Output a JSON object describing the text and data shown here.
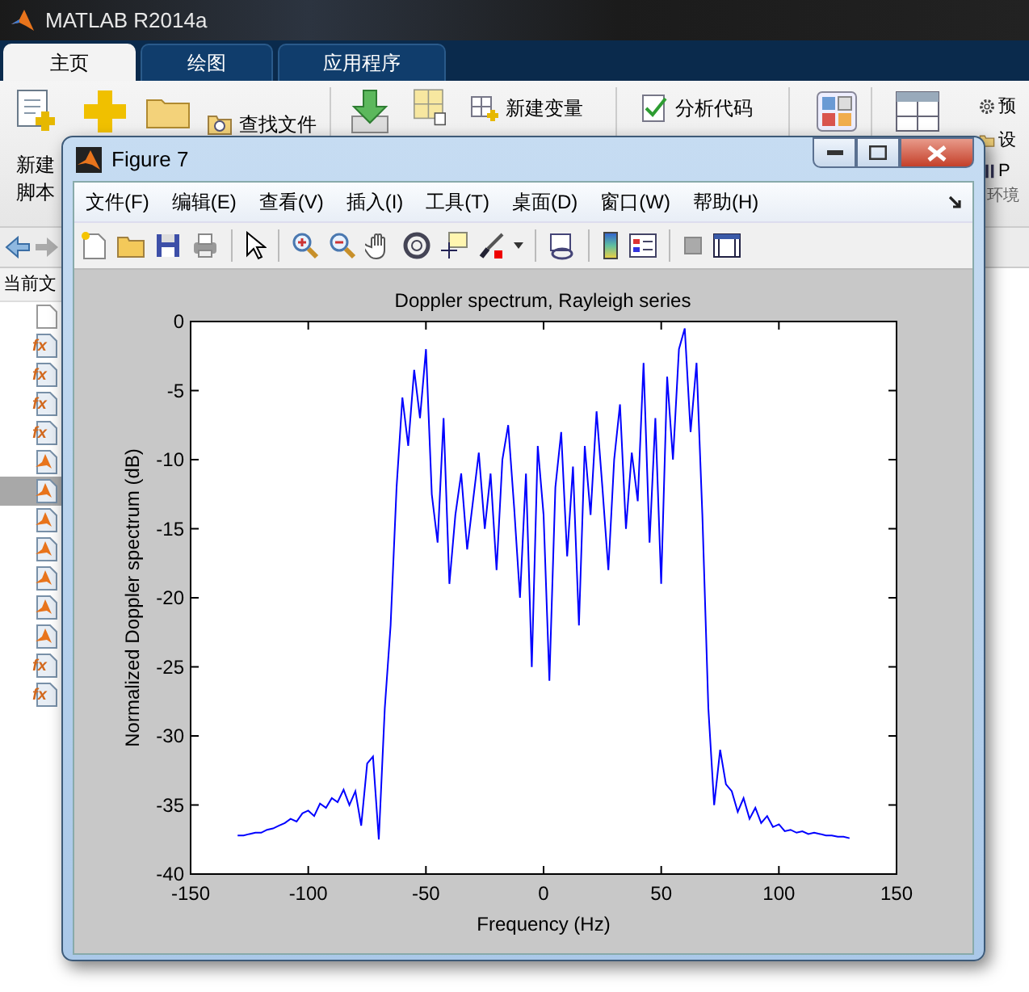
{
  "app": {
    "title": "MATLAB R2014a"
  },
  "tabs": [
    {
      "label": "主页",
      "selected": true
    },
    {
      "label": "绘图",
      "selected": false
    },
    {
      "label": "应用程序",
      "selected": false
    }
  ],
  "ribbon": {
    "new_script": "新建脚本",
    "find_files": "查找文件",
    "new_variable": "新建变量",
    "analyze_code": "分析代码",
    "preferences": "预",
    "set_path": "设",
    "parallel": "P",
    "section": "环境"
  },
  "current_folder": {
    "title": "当前文",
    "files": [
      {
        "kind": "blank",
        "selected": false
      },
      {
        "kind": "function",
        "badge": "fx",
        "selected": false
      },
      {
        "kind": "function",
        "badge": "fx",
        "selected": false
      },
      {
        "kind": "function",
        "badge": "fx",
        "selected": false
      },
      {
        "kind": "function",
        "badge": "fx",
        "selected": false
      },
      {
        "kind": "script",
        "selected": false
      },
      {
        "kind": "script",
        "selected": true
      },
      {
        "kind": "script",
        "selected": false
      },
      {
        "kind": "script",
        "selected": false
      },
      {
        "kind": "script",
        "selected": false
      },
      {
        "kind": "script",
        "selected": false
      },
      {
        "kind": "script",
        "selected": false
      },
      {
        "kind": "function",
        "badge": "fx",
        "selected": false
      },
      {
        "kind": "function",
        "badge": "fx",
        "selected": false
      }
    ]
  },
  "figure": {
    "title": "Figure 7",
    "menu": [
      "文件(F)",
      "编辑(E)",
      "查看(V)",
      "插入(I)",
      "工具(T)",
      "桌面(D)",
      "窗口(W)",
      "帮助(H)"
    ],
    "chart_data": {
      "type": "line",
      "title": "Doppler spectrum, Rayleigh series",
      "xlabel": "Frequency (Hz)",
      "ylabel": "Normalized Doppler spectrum (dB)",
      "x": [
        -130,
        -127.5,
        -125,
        -122.5,
        -120,
        -117.5,
        -115,
        -112.5,
        -110,
        -107.5,
        -105,
        -102.5,
        -100,
        -97.5,
        -95,
        -92.5,
        -90,
        -87.5,
        -85,
        -82.5,
        -80,
        -77.5,
        -75,
        -72.5,
        -70,
        -67.5,
        -65,
        -62.5,
        -60,
        -57.5,
        -55,
        -52.5,
        -50,
        -47.5,
        -45,
        -42.5,
        -40,
        -37.5,
        -35,
        -32.5,
        -30,
        -27.5,
        -25,
        -22.5,
        -20,
        -17.5,
        -15,
        -12.5,
        -10,
        -7.5,
        -5,
        -2.5,
        0,
        2.5,
        5,
        7.5,
        10,
        12.5,
        15,
        17.5,
        20,
        22.5,
        25,
        27.5,
        30,
        32.5,
        35,
        37.5,
        40,
        42.5,
        45,
        47.5,
        50,
        52.5,
        55,
        57.5,
        60,
        62.5,
        65,
        67.5,
        70,
        72.5,
        75,
        77.5,
        80,
        82.5,
        85,
        87.5,
        90,
        92.5,
        95,
        97.5,
        100,
        102.5,
        105,
        107.5,
        110,
        112.5,
        115,
        117.5,
        120,
        122.5,
        125,
        127.5,
        130
      ],
      "series": [
        {
          "color": "#0000ff",
          "values": [
            -37.2,
            -37.2,
            -37.1,
            -37.0,
            -37.0,
            -36.8,
            -36.7,
            -36.5,
            -36.3,
            -36.0,
            -36.2,
            -35.6,
            -35.4,
            -35.8,
            -34.9,
            -35.2,
            -34.5,
            -34.8,
            -33.9,
            -35.0,
            -34.0,
            -36.5,
            -32.0,
            -31.5,
            -37.5,
            -28.0,
            -22.0,
            -12.0,
            -5.5,
            -9.0,
            -3.5,
            -7.0,
            -2.0,
            -12.5,
            -16.0,
            -7.0,
            -19.0,
            -14.0,
            -11.0,
            -16.5,
            -13.0,
            -9.5,
            -15.0,
            -11.0,
            -18.0,
            -10.0,
            -7.5,
            -13.5,
            -20.0,
            -11.0,
            -25.0,
            -9.0,
            -14.0,
            -26,
            -12,
            -8,
            -17,
            -10.5,
            -22,
            -9,
            -14,
            -6.5,
            -12,
            -18,
            -10,
            -6,
            -15,
            -9.5,
            -13,
            -3,
            -16,
            -7,
            -19,
            -4,
            -10,
            -2,
            -0.5,
            -8,
            -3,
            -14,
            -28,
            -35,
            -31,
            -33.5,
            -34,
            -35.5,
            -34.5,
            -36,
            -35.2,
            -36.3,
            -35.8,
            -36.6,
            -36.4,
            -36.9,
            -36.8,
            -37,
            -36.9,
            -37.1,
            -37,
            -37.1,
            -37.2,
            -37.2,
            -37.3,
            -37.3,
            -37.4
          ]
        }
      ],
      "xlim": [
        -150,
        150
      ],
      "ylim": [
        -40,
        0
      ],
      "xticks": [
        -150,
        -100,
        -50,
        0,
        50,
        100,
        150
      ],
      "yticks": [
        -40,
        -35,
        -30,
        -25,
        -20,
        -15,
        -10,
        -5,
        0
      ]
    }
  }
}
